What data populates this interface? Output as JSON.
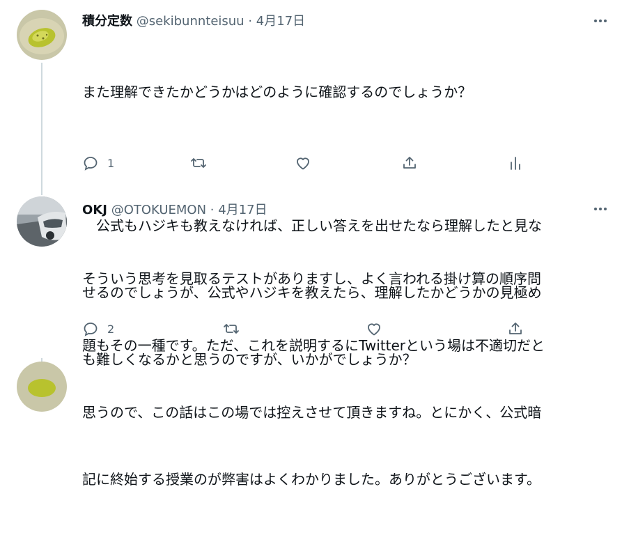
{
  "tweets": [
    {
      "display_name": "積分定数",
      "handle": "@sekibunnteisuu",
      "separator": "·",
      "date": "4月17日",
      "lines": [
        "また理解できたかどうかはどのように確認するのでしょうか？",
        "",
        "　公式もハジキも教えなければ、正しい答えを出せたなら理解したと見な",
        "せるのでしょうが、公式やハジキを教えたら、理解したかどうかの見極め",
        "も難しくなるかと思うのですが、いかがでしょうか？"
      ],
      "reply_count": "1",
      "retweet_count": "",
      "like_count": ""
    },
    {
      "display_name": "OKJ",
      "handle": "@OTOKUEMON",
      "separator": "·",
      "date": "4月17日",
      "lines": [
        "そういう思考を見取るテストがありますし、よく言われる掛け算の順序問",
        "題もその一種です。ただ、これを説明するにTwitterという場は不適切だと",
        "思うので、この話はこの場では控えさせて頂きますね。とにかく、公式暗",
        "記に終始する授業のが弊害はよくわかりました。ありがとうございます。"
      ],
      "reply_count": "2",
      "retweet_count": "",
      "like_count": ""
    }
  ],
  "icons": {
    "more": "more-horizontal-icon",
    "reply": "reply-icon",
    "retweet": "retweet-icon",
    "like": "like-icon",
    "share": "share-icon",
    "analytics": "analytics-icon"
  },
  "colors": {
    "text": "#0f1419",
    "secondary": "#536471",
    "thread_line": "#cfd9de",
    "background": "#ffffff"
  }
}
